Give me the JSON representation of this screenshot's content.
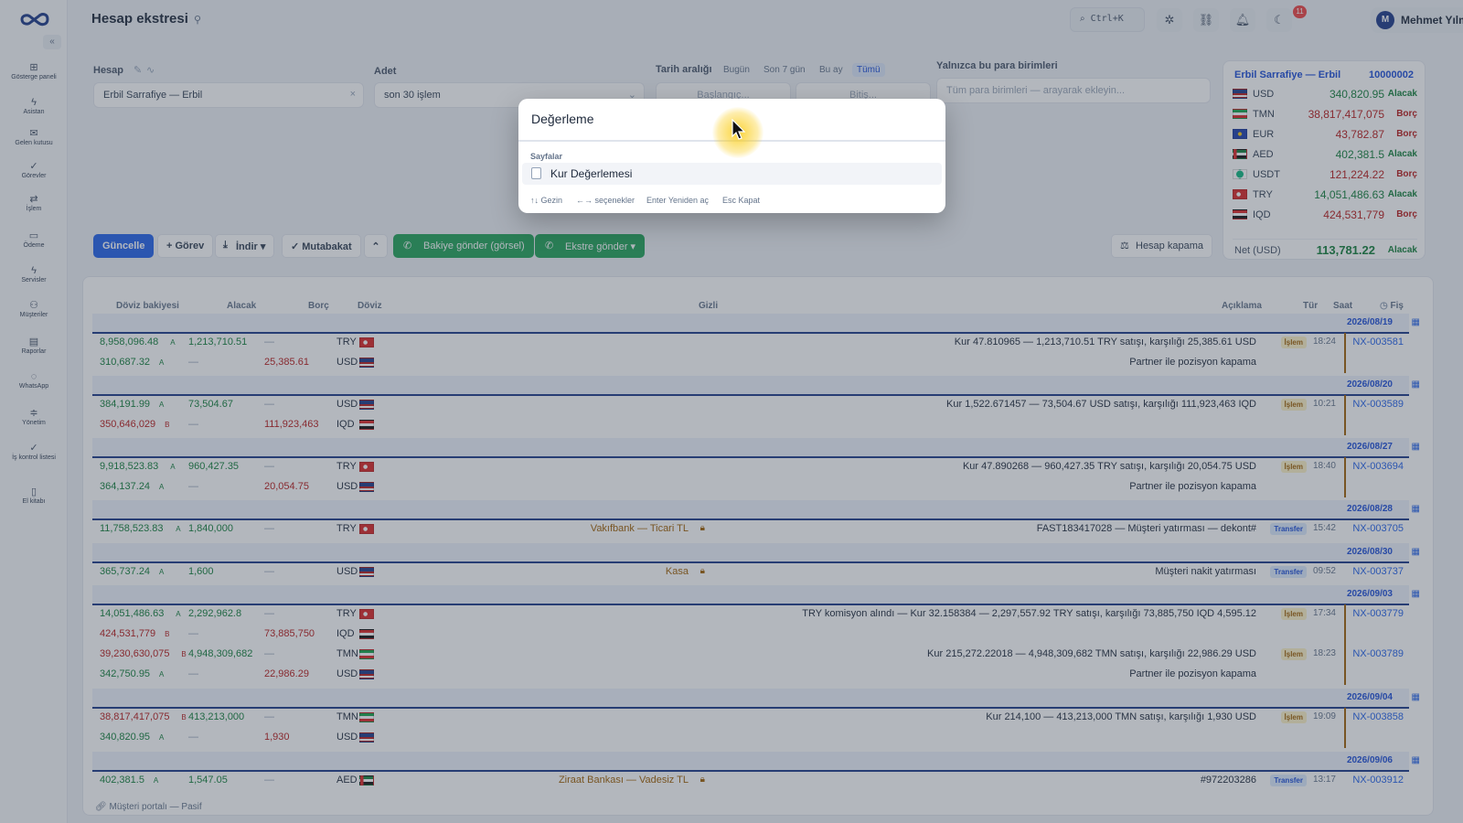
{
  "page": {
    "title": "Hesap ekstresi"
  },
  "sidebar": {
    "items": [
      {
        "label": "Gösterge paneli",
        "icon": "dashboard-icon"
      },
      {
        "label": "Asistan",
        "icon": "bolt-icon"
      },
      {
        "label": "Gelen kutusu",
        "icon": "inbox-icon"
      },
      {
        "label": "Görevler",
        "icon": "check-icon"
      },
      {
        "label": "İşlem",
        "icon": "swap-icon"
      },
      {
        "label": "Ödeme",
        "icon": "wallet-icon"
      },
      {
        "label": "Servisler",
        "icon": "bolt-icon"
      },
      {
        "label": "Müşteriler",
        "icon": "users-icon"
      },
      {
        "label": "Raporlar",
        "icon": "report-icon"
      },
      {
        "label": "WhatsApp",
        "icon": "chat-icon"
      },
      {
        "label": "Yönetim",
        "icon": "sliders-icon"
      },
      {
        "label": "İş kontrol listesi",
        "icon": "check-icon"
      },
      {
        "label": "El kitabı",
        "icon": "book-icon"
      }
    ]
  },
  "topbar": {
    "shortcut": "Ctrl+K",
    "notifications": "11",
    "user_initial": "M",
    "user_name": "Mehmet Yılmaz"
  },
  "filters": {
    "account_label": "Hesap",
    "account_value": "Erbil Sarrafiye — Erbil",
    "count_label": "Adet",
    "count_value": "son 30 işlem",
    "date_label": "Tarih aralığı",
    "date_pills": [
      "Bugün",
      "Son 7 gün",
      "Bu ay",
      "Tümü"
    ],
    "date_start_placeholder": "Başlangıç...",
    "date_end_placeholder": "Bitiş...",
    "currency_label": "Yalnızca bu para birimleri",
    "currency_placeholder": "Tüm para birimleri — arayarak ekleyin..."
  },
  "actions": {
    "update": "Güncelle",
    "task": "+ Görev",
    "download": "İndir ▾",
    "reconcile": "✓ Mutabakat",
    "collapse": "⌃",
    "send_balance": "Bakiye gönder (görsel)",
    "send_statement": "Ekstre gönder ▾",
    "close_account": "Hesap kapama"
  },
  "balances": {
    "account_name": "Erbil Sarrafiye — Erbil",
    "account_no": "10000002",
    "rows": [
      {
        "cur": "USD",
        "value": "340,820.95",
        "side": "Alacak"
      },
      {
        "cur": "TMN",
        "value": "38,817,417,075",
        "side": "Borç"
      },
      {
        "cur": "EUR",
        "value": "43,782.87",
        "side": "Borç"
      },
      {
        "cur": "AED",
        "value": "402,381.5",
        "side": "Alacak"
      },
      {
        "cur": "USDT",
        "value": "121,224.22",
        "side": "Borç"
      },
      {
        "cur": "TRY",
        "value": "14,051,486.63",
        "side": "Alacak"
      },
      {
        "cur": "IQD",
        "value": "424,531,779",
        "side": "Borç"
      }
    ],
    "net_label": "Net (USD)",
    "net_value": "113,781.22",
    "net_side": "Alacak"
  },
  "table": {
    "headers": [
      "Döviz bakiyesi",
      "Alacak",
      "Borç",
      "Döviz",
      "Gizli",
      "Açıklama",
      "Tür",
      "Saat",
      "Fiş"
    ],
    "dates": [
      "2026/08/19",
      "2026/08/20",
      "2026/08/27",
      "2026/08/28",
      "2026/08/30",
      "2026/09/03",
      "2026/09/04",
      "2026/09/06"
    ],
    "rows": [
      {
        "bal": "8,958,096.48",
        "bs": "A",
        "alacak": "1,213,710.51",
        "borc": "—",
        "cur": "TRY",
        "gizli": "",
        "desc": "Kur 47.810965 — 1,213,710.51 TRY satışı, karşılığı 25,385.61 USD",
        "tur": "İşlem",
        "saat": "18:24",
        "fis": "NX-003581"
      },
      {
        "bal": "310,687.32",
        "bs": "A",
        "alacak": "—",
        "borc": "25,385.61",
        "cur": "USD",
        "gizli": "",
        "desc": "Partner ile pozisyon kapama",
        "tur": "",
        "saat": "",
        "fis": ""
      },
      {
        "bal": "384,191.99",
        "bs": "A",
        "alacak": "73,504.67",
        "borc": "—",
        "cur": "USD",
        "gizli": "",
        "desc": "Kur 1,522.671457 — 73,504.67 USD satışı, karşılığı 111,923,463 IQD",
        "tur": "İşlem",
        "saat": "10:21",
        "fis": "NX-003589"
      },
      {
        "bal": "350,646,029",
        "bs": "B",
        "alacak": "—",
        "borc": "111,923,463",
        "cur": "IQD",
        "gizli": "",
        "desc": "",
        "tur": "",
        "saat": "",
        "fis": ""
      },
      {
        "bal": "9,918,523.83",
        "bs": "A",
        "alacak": "960,427.35",
        "borc": "—",
        "cur": "TRY",
        "gizli": "",
        "desc": "Kur 47.890268 — 960,427.35 TRY satışı, karşılığı 20,054.75 USD",
        "tur": "İşlem",
        "saat": "18:40",
        "fis": "NX-003694"
      },
      {
        "bal": "364,137.24",
        "bs": "A",
        "alacak": "—",
        "borc": "20,054.75",
        "cur": "USD",
        "gizli": "",
        "desc": "Partner ile pozisyon kapama",
        "tur": "",
        "saat": "",
        "fis": ""
      },
      {
        "bal": "11,758,523.83",
        "bs": "A",
        "alacak": "1,840,000",
        "borc": "—",
        "cur": "TRY",
        "gizli": "Vakıfbank — Ticari TL",
        "desc": "FAST183417028 — Müşteri yatırması — dekont#",
        "tur": "Transfer",
        "saat": "15:42",
        "fis": "NX-003705"
      },
      {
        "bal": "365,737.24",
        "bs": "A",
        "alacak": "1,600",
        "borc": "—",
        "cur": "USD",
        "gizli": "Kasa",
        "desc": "Müşteri nakit yatırması",
        "tur": "Transfer",
        "saat": "09:52",
        "fis": "NX-003737"
      },
      {
        "bal": "14,051,486.63",
        "bs": "A",
        "alacak": "2,292,962.8",
        "borc": "—",
        "cur": "TRY",
        "gizli": "",
        "desc": "TRY komisyon alındı — Kur 32.158384 — 2,297,557.92 TRY satışı, karşılığı 73,885,750 IQD 4,595.12",
        "tur": "İşlem",
        "saat": "17:34",
        "fis": "NX-003779"
      },
      {
        "bal": "424,531,779",
        "bs": "B",
        "alacak": "—",
        "borc": "73,885,750",
        "cur": "IQD",
        "gizli": "",
        "desc": "",
        "tur": "",
        "saat": "",
        "fis": ""
      },
      {
        "bal": "39,230,630,075",
        "bs": "B",
        "alacak": "4,948,309,682",
        "borc": "—",
        "cur": "TMN",
        "gizli": "",
        "desc": "Kur 215,272.22018 — 4,948,309,682 TMN satışı, karşılığı 22,986.29 USD",
        "tur": "İşlem",
        "saat": "18:23",
        "fis": "NX-003789"
      },
      {
        "bal": "342,750.95",
        "bs": "A",
        "alacak": "—",
        "borc": "22,986.29",
        "cur": "USD",
        "gizli": "",
        "desc": "Partner ile pozisyon kapama",
        "tur": "",
        "saat": "",
        "fis": ""
      },
      {
        "bal": "38,817,417,075",
        "bs": "B",
        "alacak": "413,213,000",
        "borc": "—",
        "cur": "TMN",
        "gizli": "",
        "desc": "Kur 214,100 — 413,213,000 TMN satışı, karşılığı 1,930 USD",
        "tur": "İşlem",
        "saat": "19:09",
        "fis": "NX-003858"
      },
      {
        "bal": "340,820.95",
        "bs": "A",
        "alacak": "—",
        "borc": "1,930",
        "cur": "USD",
        "gizli": "",
        "desc": "",
        "tur": "",
        "saat": "",
        "fis": ""
      },
      {
        "bal": "402,381.5",
        "bs": "A",
        "alacak": "1,547.05",
        "borc": "—",
        "cur": "AED",
        "gizli": "Ziraat Bankası — Vadesiz TL",
        "desc": "#972203286",
        "tur": "Transfer",
        "saat": "13:17",
        "fis": "NX-003912"
      }
    ]
  },
  "footer": {
    "portal": "Müşteri portalı — Pasif"
  },
  "modal": {
    "query": "Değerleme",
    "section": "Sayfalar",
    "result": "Kur Değerlemesi",
    "hints": [
      "↑↓ Gezin",
      "←→ seçenekler",
      "Enter Yeniden aç",
      "Esc Kapat"
    ]
  },
  "colors": {
    "accent": "#2563eb",
    "credit": "#15803d",
    "debit": "#b91c1c",
    "whatsapp": "#22a35a"
  }
}
